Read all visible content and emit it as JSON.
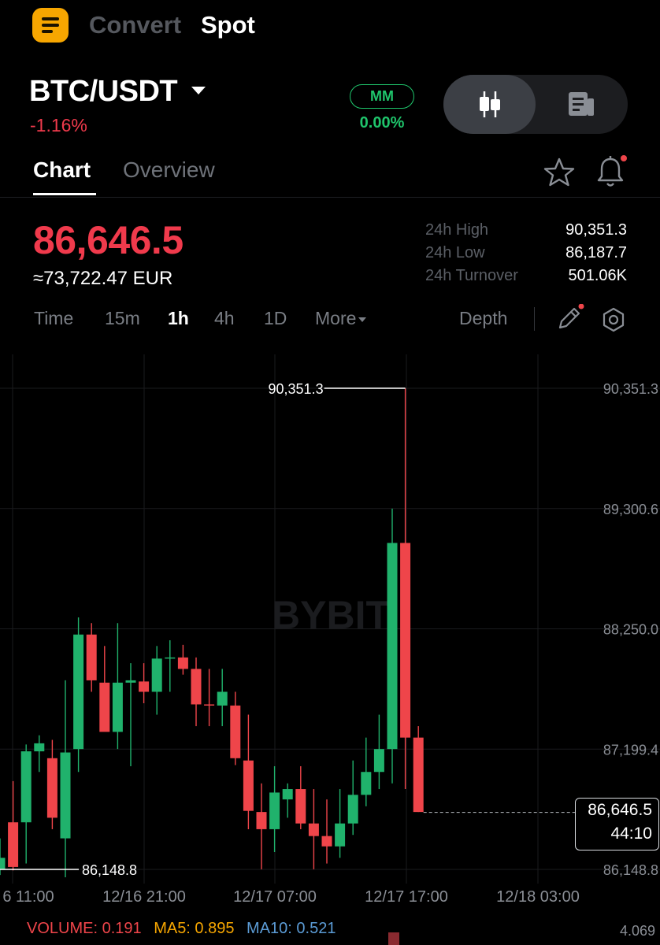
{
  "header": {
    "tabs": [
      {
        "label": "Convert",
        "active": false
      },
      {
        "label": "Spot",
        "active": true
      }
    ]
  },
  "ticker": {
    "pair": "BTC/USDT",
    "change": "-1.16%",
    "mm_label": "MM",
    "mm_value": "0.00%"
  },
  "subtabs": [
    "Chart",
    "Overview"
  ],
  "price": {
    "last": "86,646.5",
    "eur": "≈73,722.47 EUR",
    "stats": [
      {
        "label": "24h High",
        "value": "90,351.3"
      },
      {
        "label": "24h Low",
        "value": "86,187.7"
      },
      {
        "label": "24h Turnover",
        "value": "501.06K"
      }
    ]
  },
  "intervals": {
    "items": [
      "Time",
      "15m",
      "1h",
      "4h",
      "1D",
      "More"
    ],
    "active": "1h",
    "depth_label": "Depth"
  },
  "chart": {
    "watermark": "BYBIT",
    "y_ticks": [
      "90,351.3",
      "89,300.6",
      "88,250.0",
      "87,199.4",
      "86,148.8"
    ],
    "x_ticks": [
      "6 11:00",
      "12/16 21:00",
      "12/17 07:00",
      "12/17 17:00",
      "12/18 03:00"
    ],
    "high_marker": "90,351.3",
    "low_marker": "86,148.8",
    "current_price": "86,646.5",
    "countdown": "44:10",
    "colors": {
      "up": "#20b26c",
      "down": "#ef454a"
    },
    "candles": [
      {
        "o": 86150,
        "h": 86420,
        "l": 86100,
        "c": 86250
      },
      {
        "o": 86560,
        "h": 86920,
        "l": 86140,
        "c": 86170
      },
      {
        "o": 86560,
        "h": 87240,
        "l": 86200,
        "c": 87180
      },
      {
        "o": 87180,
        "h": 87320,
        "l": 87000,
        "c": 87250
      },
      {
        "o": 87120,
        "h": 87280,
        "l": 86500,
        "c": 86600
      },
      {
        "o": 86420,
        "h": 87800,
        "l": 86080,
        "c": 87170
      },
      {
        "o": 87200,
        "h": 88350,
        "l": 87000,
        "c": 88200
      },
      {
        "o": 88200,
        "h": 88300,
        "l": 87700,
        "c": 87800
      },
      {
        "o": 87780,
        "h": 88100,
        "l": 87500,
        "c": 87350
      },
      {
        "o": 87350,
        "h": 88300,
        "l": 87200,
        "c": 87780
      },
      {
        "o": 87780,
        "h": 87950,
        "l": 87050,
        "c": 87800
      },
      {
        "o": 87790,
        "h": 87950,
        "l": 87600,
        "c": 87700
      },
      {
        "o": 87700,
        "h": 88100,
        "l": 87500,
        "c": 87990
      },
      {
        "o": 87990,
        "h": 88150,
        "l": 87700,
        "c": 88000
      },
      {
        "o": 88000,
        "h": 88110,
        "l": 87850,
        "c": 87900
      },
      {
        "o": 87900,
        "h": 88000,
        "l": 87400,
        "c": 87590
      },
      {
        "o": 87590,
        "h": 87900,
        "l": 87400,
        "c": 87580
      },
      {
        "o": 87580,
        "h": 87900,
        "l": 87400,
        "c": 87700
      },
      {
        "o": 87580,
        "h": 87700,
        "l": 87060,
        "c": 87120
      },
      {
        "o": 87100,
        "h": 87500,
        "l": 86500,
        "c": 86660
      },
      {
        "o": 86650,
        "h": 86900,
        "l": 86150,
        "c": 86500
      },
      {
        "o": 86500,
        "h": 87050,
        "l": 86300,
        "c": 86820
      },
      {
        "o": 86760,
        "h": 86900,
        "l": 86600,
        "c": 86850
      },
      {
        "o": 86850,
        "h": 87050,
        "l": 86500,
        "c": 86550
      },
      {
        "o": 86550,
        "h": 86850,
        "l": 86150,
        "c": 86440
      },
      {
        "o": 86440,
        "h": 86760,
        "l": 86200,
        "c": 86350
      },
      {
        "o": 86350,
        "h": 86850,
        "l": 86250,
        "c": 86550
      },
      {
        "o": 86550,
        "h": 87100,
        "l": 86450,
        "c": 86800
      },
      {
        "o": 86800,
        "h": 87300,
        "l": 86700,
        "c": 87000
      },
      {
        "o": 87000,
        "h": 87500,
        "l": 86850,
        "c": 87200
      },
      {
        "o": 87200,
        "h": 89300,
        "l": 86900,
        "c": 89000
      },
      {
        "o": 89000,
        "h": 90351.3,
        "l": 86850,
        "c": 87300
      },
      {
        "o": 87300,
        "h": 87400,
        "l": 86650,
        "c": 86650
      }
    ]
  },
  "volume": {
    "label": "VOLUME: 0.191",
    "ma5": "MA5: 0.895",
    "ma10": "MA10: 0.521",
    "max": "4.069",
    "colors": {
      "volume": "#ef454a",
      "ma5": "#f7a600",
      "ma10": "#5b9bd5"
    }
  }
}
